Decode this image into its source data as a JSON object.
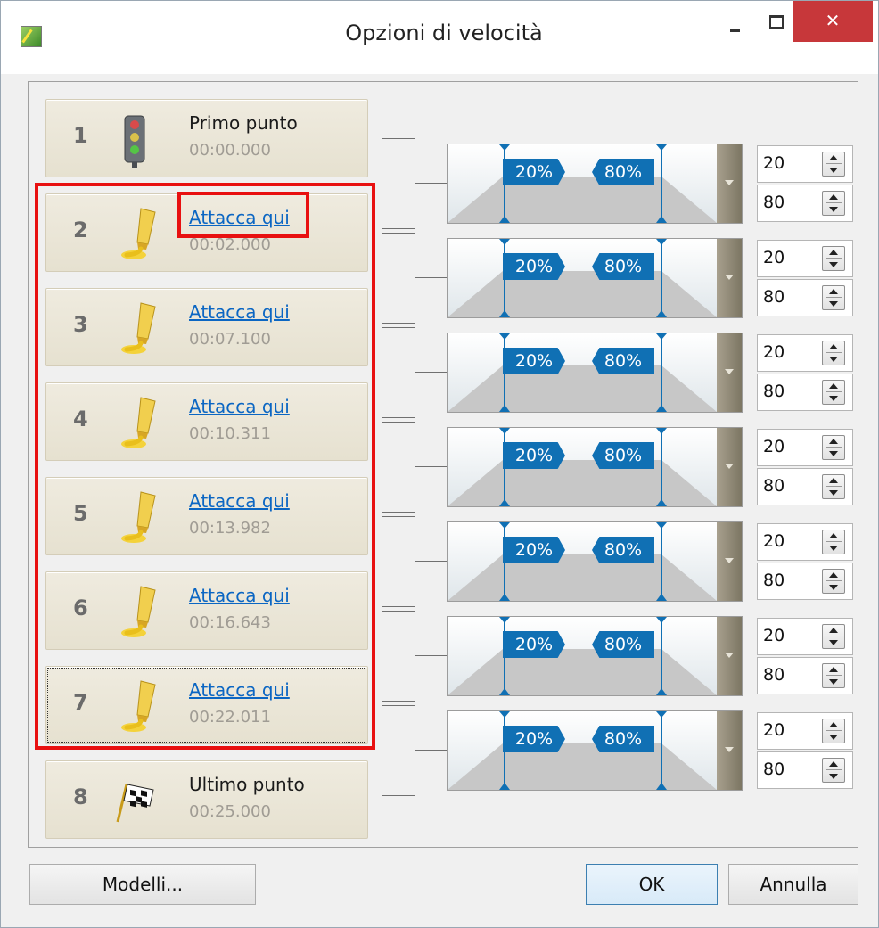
{
  "window": {
    "title": "Opzioni di velocità",
    "minimize_label": "",
    "maximize_label": "",
    "close_label": "✕"
  },
  "points": [
    {
      "num": "1",
      "label": "Primo punto",
      "time": "00:00.000",
      "icon": "traffic-light-icon",
      "link": false
    },
    {
      "num": "2",
      "label": "Attacca qui",
      "time": "00:02.000",
      "icon": "glue-tube-icon",
      "link": true
    },
    {
      "num": "3",
      "label": "Attacca qui",
      "time": "00:07.100",
      "icon": "glue-tube-icon",
      "link": true
    },
    {
      "num": "4",
      "label": "Attacca qui",
      "time": "00:10.311",
      "icon": "glue-tube-icon",
      "link": true
    },
    {
      "num": "5",
      "label": "Attacca qui",
      "time": "00:13.982",
      "icon": "glue-tube-icon",
      "link": true
    },
    {
      "num": "6",
      "label": "Attacca qui",
      "time": "00:16.643",
      "icon": "glue-tube-icon",
      "link": true
    },
    {
      "num": "7",
      "label": "Attacca qui",
      "time": "00:22.011",
      "icon": "glue-tube-icon",
      "link": true
    },
    {
      "num": "8",
      "label": "Ultimo punto",
      "time": "00:25.000",
      "icon": "checkered-flag-icon",
      "link": false
    }
  ],
  "segments": [
    {
      "left_tag": "20%",
      "right_tag": "80%",
      "start": "20",
      "end": "80"
    },
    {
      "left_tag": "20%",
      "right_tag": "80%",
      "start": "20",
      "end": "80"
    },
    {
      "left_tag": "20%",
      "right_tag": "80%",
      "start": "20",
      "end": "80"
    },
    {
      "left_tag": "20%",
      "right_tag": "80%",
      "start": "20",
      "end": "80"
    },
    {
      "left_tag": "20%",
      "right_tag": "80%",
      "start": "20",
      "end": "80"
    },
    {
      "left_tag": "20%",
      "right_tag": "80%",
      "start": "20",
      "end": "80"
    },
    {
      "left_tag": "20%",
      "right_tag": "80%",
      "start": "20",
      "end": "80"
    }
  ],
  "buttons": {
    "models": "Modelli...",
    "ok": "OK",
    "cancel": "Annulla"
  },
  "colors": {
    "highlight": "#e81010",
    "tag": "#1070b4",
    "link": "#0b66c3",
    "close": "#c7373a"
  }
}
